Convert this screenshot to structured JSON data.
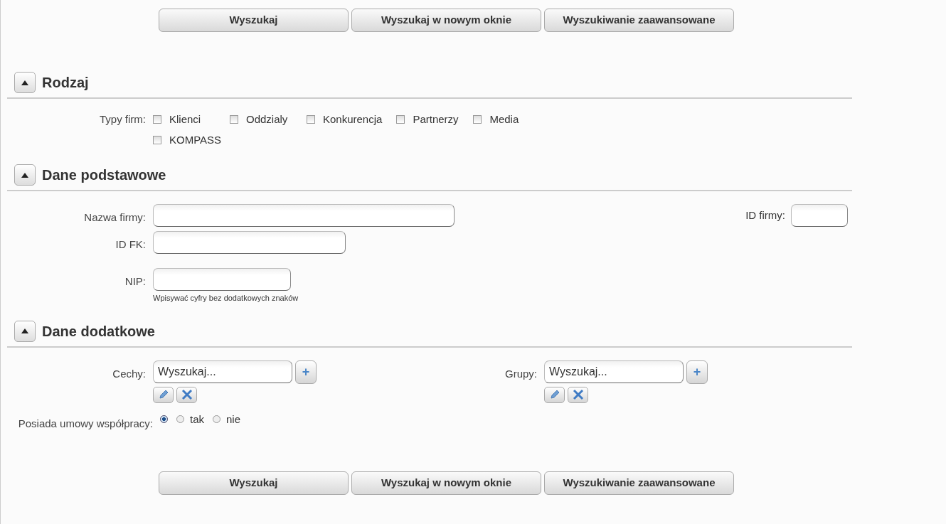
{
  "top_buttons": [
    "Wyszukaj",
    "Wyszukaj w nowym oknie",
    "Wyszukiwanie zaawansowane"
  ],
  "sections": [
    {
      "title": "Rodzaj",
      "expanded": true,
      "rows": [
        {
          "kind": "checkboxes",
          "label": "Typy firm:",
          "options": [
            {
              "label": "Klienci",
              "checked": false
            },
            {
              "label": "Oddzialy",
              "checked": false
            },
            {
              "label": "Konkurencja",
              "checked": false
            },
            {
              "label": "Partnerzy",
              "checked": false
            },
            {
              "label": "Media",
              "checked": false
            },
            {
              "label": "KOMPASS",
              "checked": false
            }
          ]
        }
      ]
    },
    {
      "title": "Dane podstawowe",
      "expanded": true,
      "rows": [
        {
          "kind": "text",
          "label": "Nazwa firmy:",
          "side": {
            "label": "ID firmy:"
          }
        },
        {
          "kind": "text",
          "label": "ID FK:"
        },
        {
          "kind": "text",
          "label": "NIP:",
          "hint": "Wpisywać cyfry bez dodatkowych znaków"
        }
      ]
    },
    {
      "title": "Dane dodatkowe",
      "expanded": true,
      "rows": [
        {
          "kind": "pickers",
          "items": [
            {
              "label": "Cechy:",
              "placeholder": "Wyszukaj...",
              "add": "+"
            },
            {
              "label": "Grupy:",
              "placeholder": "Wyszukaj...",
              "add": "+"
            }
          ]
        },
        {
          "kind": "radios",
          "label": "Posiada umowy współpracy:",
          "options": [
            {
              "selected": true
            },
            {
              "label": "tak",
              "selected": false
            },
            {
              "label": "nie",
              "selected": false
            }
          ]
        }
      ]
    }
  ],
  "bottom_buttons": [
    "Wyszukaj",
    "Wyszukaj w nowym oknie",
    "Wyszukiwanie zaawansowane"
  ]
}
